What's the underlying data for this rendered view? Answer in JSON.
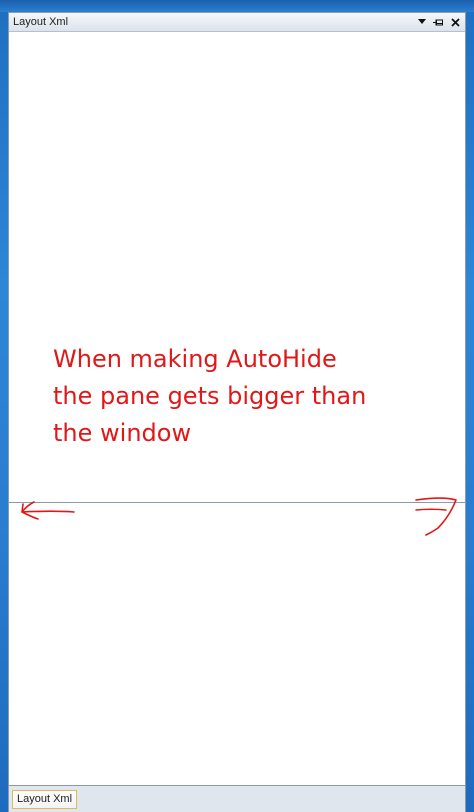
{
  "window": {
    "title": "Layout Xml",
    "buttons": [
      {
        "name": "dropdown",
        "icon": "triangle-down-icon"
      },
      {
        "name": "auto-hide",
        "icon": "pin-icon"
      },
      {
        "name": "close",
        "icon": "close-icon"
      }
    ]
  },
  "tab": {
    "label": "Layout Xml"
  },
  "annotation": {
    "text": "When making AutoHide\nthe pane gets bigger than\nthe window",
    "color": "#e01818"
  },
  "colors": {
    "desktop": "#2a7dcf",
    "tab_border": "#e6b65a"
  }
}
